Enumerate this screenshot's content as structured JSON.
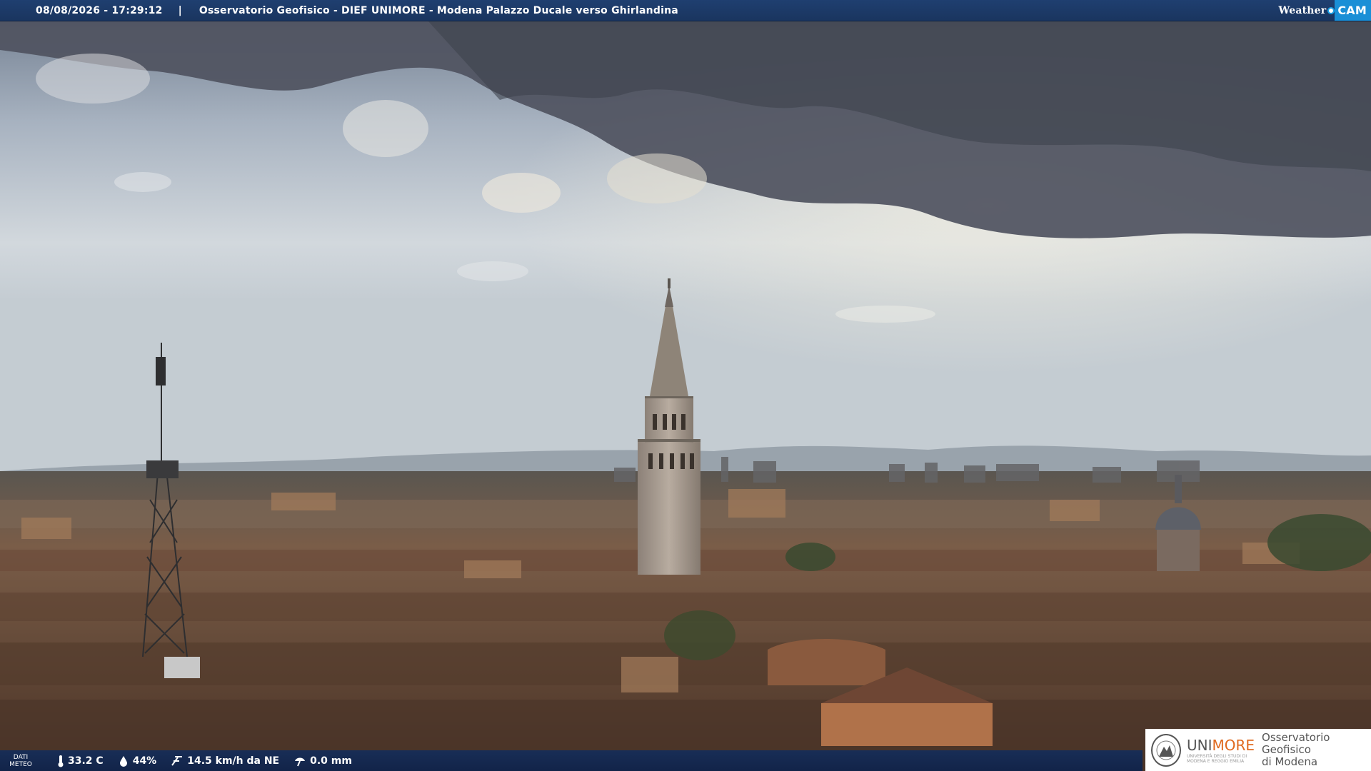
{
  "header": {
    "datetime": "08/08/2026 - 17:29:12",
    "separator": "|",
    "title": "Osservatorio Geofisico - DIEF UNIMORE - Modena Palazzo Ducale verso Ghirlandina",
    "brand_weather": "Weather",
    "brand_cam": "CAM"
  },
  "weather_bar": {
    "label_line1": "DATI",
    "label_line2": "METEO",
    "temperature": "33.2 C",
    "humidity": "44%",
    "wind": "14.5 km/h da NE",
    "rain": "0.0 mm",
    "icons": [
      "thermometer-icon",
      "humidity-drop-icon",
      "wind-icon",
      "rain-gauge-icon"
    ]
  },
  "logo": {
    "uni_prefix": "UNI",
    "uni_suffix": "MORE",
    "uni_subtitle_line1": "UNIVERSITÀ DEGLI STUDI DI",
    "uni_subtitle_line2": "MODENA E REGGIO EMILIA",
    "observatory_line1": "Osservatorio Geofisico",
    "observatory_line2": "di Modena"
  },
  "colors": {
    "bar": "#1a355f",
    "brand_cam": "#1a8fd6",
    "unimore_orange": "#e06a1f"
  }
}
